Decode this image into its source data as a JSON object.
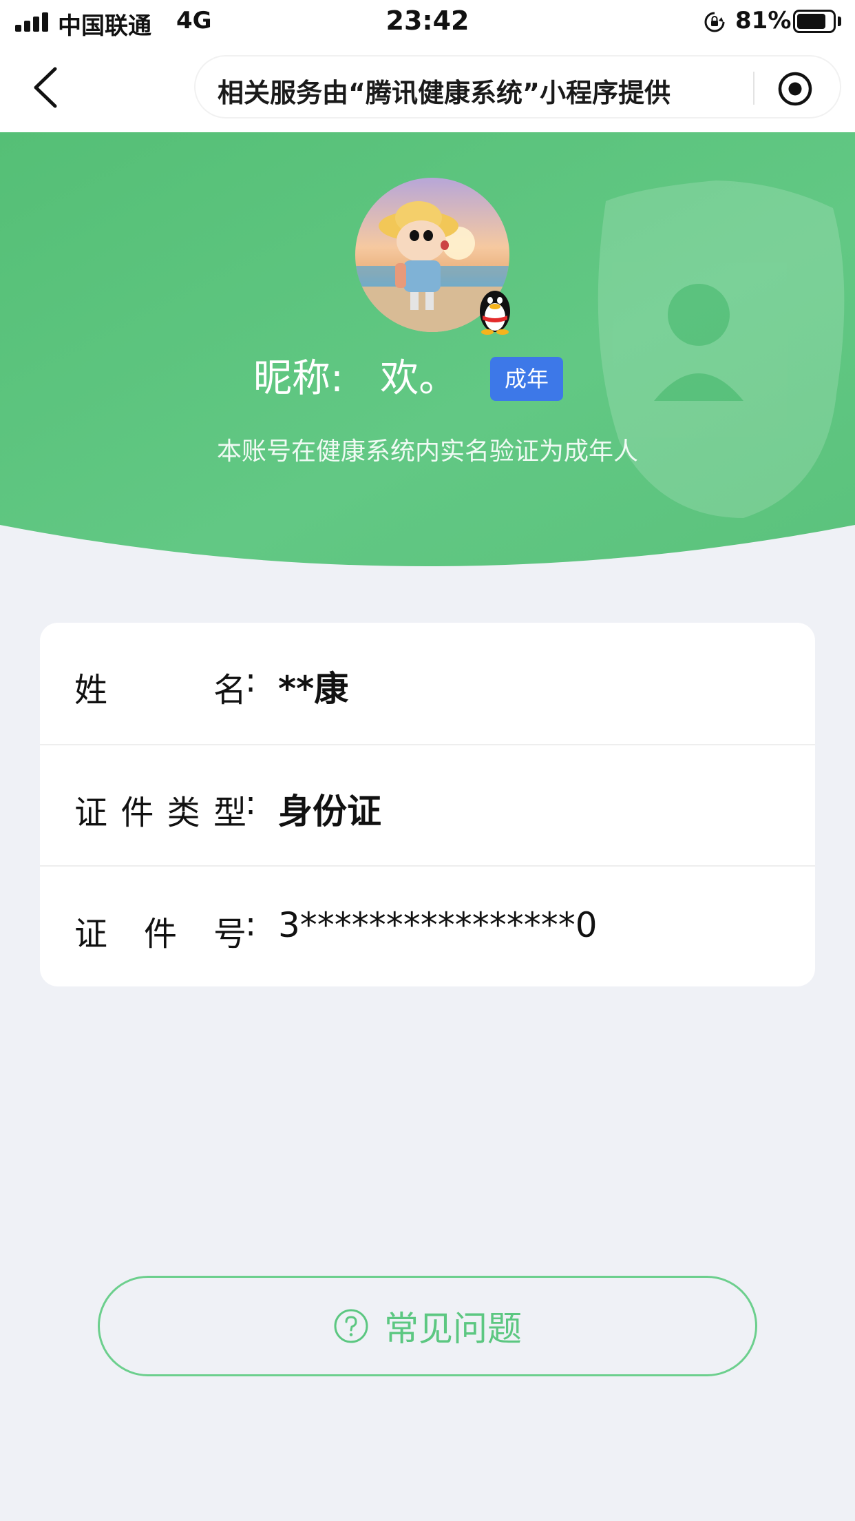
{
  "status_bar": {
    "carrier": "中国联通",
    "network": "4G",
    "time": "23:42",
    "battery_percent": "81%",
    "battery_level": 0.81,
    "icons": [
      "signal-icon",
      "rotation-lock-icon",
      "battery-icon"
    ]
  },
  "nav": {
    "back_icon": "chevron-left-icon",
    "title": "相关服务由“腾讯健康系统”小程序提供",
    "action_icon": "target-icon"
  },
  "profile": {
    "nickname_label": "昵称:",
    "nickname": "欢。",
    "age_badge": "成年",
    "verify_text": "本账号在健康系统内实名验证为成年人",
    "avatar_icon": "avatar-image",
    "platform_icon": "qq-penguin-icon"
  },
  "info": {
    "rows": [
      {
        "label_chars": [
          "姓",
          "名"
        ],
        "colon": ":",
        "value": "**康"
      },
      {
        "label_chars": [
          "证",
          "件",
          "类",
          "型"
        ],
        "colon": ":",
        "value": "身份证"
      },
      {
        "label_chars": [
          "证",
          "件",
          "号"
        ],
        "colon": ":",
        "value": "3****************0"
      }
    ]
  },
  "faq": {
    "label": "常见问题",
    "icon": "question-circle-icon"
  },
  "colors": {
    "header_green": "#5ec57f",
    "badge_blue": "#3d78e8",
    "faq_green": "#5cc781",
    "page_bg": "#eff1f6"
  }
}
